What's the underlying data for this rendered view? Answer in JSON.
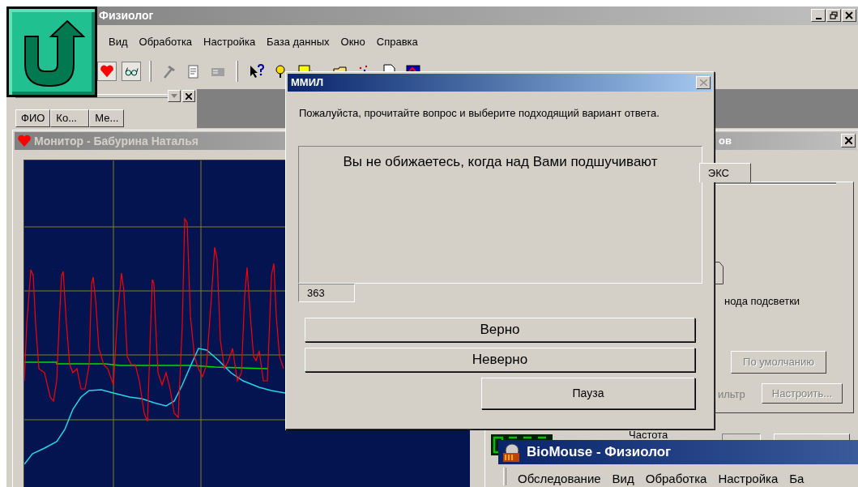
{
  "main_window": {
    "title": "Физиолог",
    "menu": [
      "Вид",
      "Обработка",
      "Настройка",
      "База данных",
      "Окно",
      "Справка"
    ]
  },
  "patient_list": {
    "columns": [
      "ФИО",
      "Ко...",
      "Ме..."
    ]
  },
  "monitor_window": {
    "title": "Монитор - Бабурина Наталья"
  },
  "settings_window": {
    "title": "ов",
    "tab": "ЭКС",
    "backlight_label": "нода подсветки",
    "filter_label": "ильтр",
    "frequency_label": "Частота",
    "buttons": [
      {
        "label": "По умолчанию",
        "disabled": true
      },
      {
        "label": "Настроить...",
        "disabled": true
      }
    ]
  },
  "dialog": {
    "title": "ММИЛ",
    "instruction": "Пожалуйста, прочитайте вопрос и выберите подходящий вариант ответа.",
    "question": "Вы не обижаетесь, когда над Вами подшучивают",
    "counter": "363",
    "buttons": [
      {
        "label": "Верно",
        "kind": "answer"
      },
      {
        "label": "Неверно",
        "kind": "answer"
      },
      {
        "label": "Пауза",
        "kind": "control"
      }
    ]
  },
  "bottom_window": {
    "title": "BioMouse - Физиолог",
    "menu": [
      "Обследование",
      "Вид",
      "Обработка",
      "Настройка",
      "Ба"
    ]
  }
}
